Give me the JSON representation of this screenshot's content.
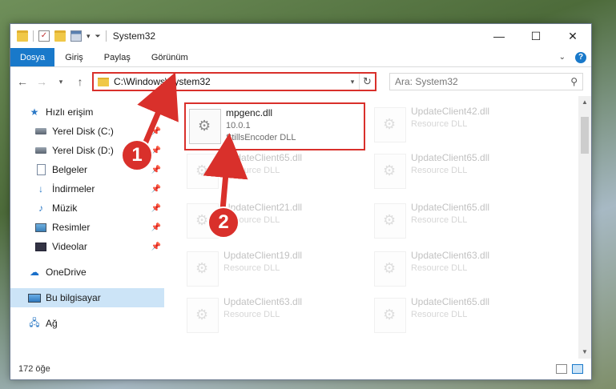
{
  "window": {
    "title": "System32",
    "minimize": "—",
    "maximize": "☐",
    "close": "✕"
  },
  "ribbon": {
    "tabs": [
      "Dosya",
      "Giriş",
      "Paylaş",
      "Görünüm"
    ]
  },
  "navigation": {
    "back": "←",
    "forward": "→",
    "up": "↑",
    "address": "C:\\Windows\\System32",
    "search_placeholder": "Ara: System32"
  },
  "sidebar": {
    "items": [
      {
        "label": "Hızlı erişim",
        "icon": "star-icon"
      },
      {
        "label": "Yerel Disk (C:)",
        "icon": "disk-icon"
      },
      {
        "label": "Yerel Disk (D:)",
        "icon": "disk-icon"
      },
      {
        "label": "Belgeler",
        "icon": "documents-icon"
      },
      {
        "label": "İndirmeler",
        "icon": "download-icon"
      },
      {
        "label": "Müzik",
        "icon": "music-icon"
      },
      {
        "label": "Resimler",
        "icon": "pictures-icon"
      },
      {
        "label": "Videolar",
        "icon": "videos-icon"
      },
      {
        "label": "OneDrive",
        "icon": "cloud-icon"
      },
      {
        "label": "Bu bilgisayar",
        "icon": "computer-icon"
      },
      {
        "label": "Ağ",
        "icon": "network-icon"
      }
    ]
  },
  "files": [
    {
      "name": "mpgenc.dll",
      "line1": "10.0.1",
      "line2": "StillsEncoder DLL"
    },
    {
      "name": "UpdateClient42.dll",
      "line1": "Resource DLL"
    },
    {
      "name": "UpdateClient65.dll",
      "line1": "Resource DLL"
    },
    {
      "name": "UpdateClient65.dll",
      "line1": "Resource DLL"
    },
    {
      "name": "UpdateClient21.dll",
      "line1": "Resource DLL"
    },
    {
      "name": "UpdateClient65.dll",
      "line1": "Resource DLL"
    },
    {
      "name": "UpdateClient19.dll",
      "line1": "Resource DLL"
    },
    {
      "name": "UpdateClient63.dll",
      "line1": "Resource DLL"
    },
    {
      "name": "UpdateClient63.dll",
      "line1": "Resource DLL"
    },
    {
      "name": "UpdateClient65.dll",
      "line1": "Resource DLL"
    }
  ],
  "status": {
    "count": "172 öğe"
  },
  "annotations": {
    "step1": "1",
    "step2": "2",
    "color": "#d9302b"
  },
  "colors": {
    "accent": "#1979ca",
    "highlight": "#d9302b",
    "selected": "#cce4f7"
  }
}
